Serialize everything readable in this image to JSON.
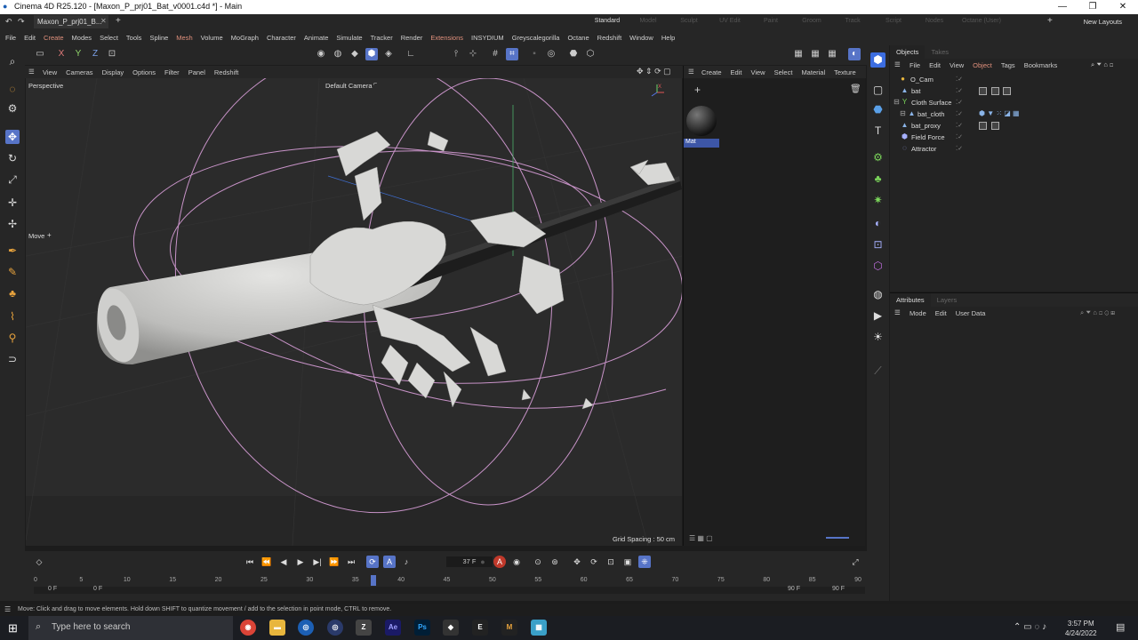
{
  "window": {
    "title": "Cinema 4D R25.120 - [Maxon_P_prj01_Bat_v0001.c4d *] - Main",
    "controls": [
      "—",
      "❐",
      "✕"
    ]
  },
  "tabs": {
    "document_tab": "Maxon_P_prj01_B...",
    "layouts": [
      "Standard",
      "Model",
      "Sculpt",
      "UV Edit",
      "Paint",
      "Groom",
      "Track",
      "Script",
      "Nodes",
      "Octane (User)"
    ],
    "active_layout": "Standard",
    "new_layouts": "New Layouts"
  },
  "menu": [
    "File",
    "Edit",
    "Create",
    "Modes",
    "Select",
    "Tools",
    "Spline",
    "Mesh",
    "Volume",
    "MoGraph",
    "Character",
    "Animate",
    "Simulate",
    "Tracker",
    "Render",
    "Extensions",
    "INSYDIUM",
    "Greyscalegorilla",
    "Octane",
    "Redshift",
    "Window",
    "Help"
  ],
  "viewport": {
    "menu": [
      "View",
      "Cameras",
      "Display",
      "Options",
      "Filter",
      "Panel",
      "Redshift"
    ],
    "name": "Perspective",
    "camera": "Default Camera",
    "tool_label": "Move",
    "grid_spacing": "Grid Spacing : 50 cm",
    "axis_labels": {
      "x": "X",
      "y": "Y",
      "z": "Z"
    }
  },
  "toolbar": {
    "axis_x": "X",
    "axis_y": "Y",
    "axis_z": "Z"
  },
  "material_manager": {
    "menu": [
      "Create",
      "Edit",
      "View",
      "Select",
      "Material",
      "Texture"
    ],
    "material_name": "Mat"
  },
  "objects_panel": {
    "tabs": [
      "Objects",
      "Takes"
    ],
    "menu": [
      "File",
      "Edit",
      "View",
      "Object",
      "Tags",
      "Bookmarks"
    ],
    "objects": [
      {
        "name": "O_Cam",
        "icon": "camera-icon"
      },
      {
        "name": "bat",
        "icon": "polygon-object-icon"
      },
      {
        "name": "Cloth Surface",
        "icon": "cloth-surface-icon"
      },
      {
        "name": "bat_cloth",
        "icon": "polygon-object-icon"
      },
      {
        "name": "bat_proxy",
        "icon": "polygon-object-icon"
      },
      {
        "name": "Field Force",
        "icon": "field-force-icon"
      },
      {
        "name": "Attractor",
        "icon": "attractor-icon"
      }
    ]
  },
  "attributes_panel": {
    "tabs": [
      "Attributes",
      "Layers"
    ],
    "menu": [
      "Mode",
      "Edit",
      "User Data"
    ]
  },
  "timeline": {
    "current_frame": "37 F",
    "current_frame_value": 37,
    "ticks": [
      "0",
      "5",
      "10",
      "15",
      "20",
      "25",
      "30",
      "35",
      "40",
      "45",
      "50",
      "55",
      "60",
      "65",
      "70",
      "75",
      "80",
      "85",
      "90"
    ],
    "range_start": "0 F",
    "range_start_2": "0 F",
    "range_end": "90 F",
    "range_end_2": "90 F",
    "playhead_label": "37"
  },
  "status": {
    "text": "Move: Click and drag to move elements. Hold down SHIFT to quantize movement / add to the selection in point mode, CTRL to remove."
  },
  "taskbar": {
    "search_placeholder": "Type here to search",
    "apps": [
      "Chrome",
      "Explorer",
      "Cinema 4D",
      "Cinema 4D",
      "Zbrush",
      "Ae",
      "Ps",
      "App",
      "EPIC",
      "M",
      "App"
    ],
    "time": "3:57 PM",
    "date": "4/24/2022"
  },
  "colors": {
    "selected": "#5774c7",
    "highlight_menu": "#e0907c",
    "viewport_bg": "#2a2a2a",
    "panel_bg": "#232323"
  }
}
